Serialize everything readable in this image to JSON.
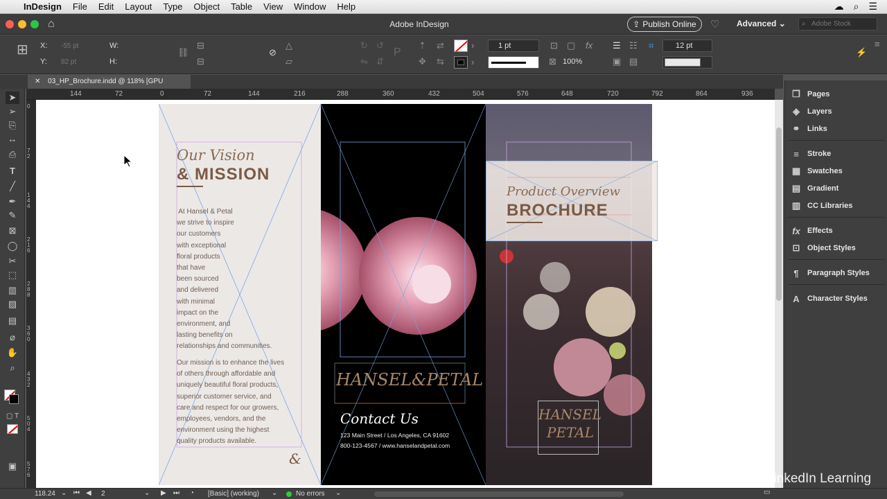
{
  "menubar": {
    "app_name": "InDesign",
    "items": [
      "File",
      "Edit",
      "Layout",
      "Type",
      "Object",
      "Table",
      "View",
      "Window",
      "Help"
    ]
  },
  "titlebar": {
    "title": "Adobe InDesign",
    "publish_label": "Publish Online",
    "workspace_label": "Advanced",
    "search_placeholder": "Adobe Stock"
  },
  "control_panel": {
    "x_label": "X:",
    "x_value": "-55 pt",
    "y_label": "Y:",
    "y_value": "82 pt",
    "w_label": "W:",
    "h_label": "H:",
    "stroke_weight": "1 pt",
    "opacity": "100%",
    "corner_size": "12 pt"
  },
  "document_tab": {
    "label": "03_HP_Brochure.indd @ 118% [GPU Preview]"
  },
  "ruler": {
    "h_ticks": [
      "144",
      "72",
      "0",
      "72",
      "144",
      "216",
      "288",
      "360",
      "432",
      "504",
      "576",
      "648",
      "720",
      "792",
      "864",
      "936"
    ],
    "v_ticks": [
      "0",
      "7\n2",
      "1\n4\n4",
      "2\n1\n6",
      "2\n8\n8",
      "3\n6\n0",
      "4\n3\n2",
      "5\n0\n4",
      "5\n7\n6"
    ]
  },
  "panels": {
    "items": [
      "Pages",
      "Layers",
      "Links",
      "Stroke",
      "Swatches",
      "Gradient",
      "CC Libraries",
      "Effects",
      "Object Styles",
      "Paragraph Styles",
      "Character Styles"
    ]
  },
  "brochure": {
    "mission_script": "Our Vision",
    "mission_title": "& MISSION",
    "mission_body_1": [
      " At Hansel & Petal",
      "we strive to inspire",
      "our customers",
      "with exceptional",
      "floral products",
      "that have",
      "been sourced",
      "and delivered",
      "with minimal",
      "impact on the",
      "environment, and",
      "lasting benefits on",
      "relationships and communities."
    ],
    "mission_body_2": [
      "Our mission is to enhance the lives",
      "of others through affordable and",
      "uniquely beautiful floral products,",
      "superior customer service, and",
      "care and respect for our growers,",
      "employees, vendors, and the",
      "environment using the highest",
      "quality products available."
    ],
    "logo_text": "HANSEL&PETAL",
    "contact_title": "Contact Us",
    "contact_address": "123 Main Street  /  Los Angeles, CA 91602",
    "contact_phone_web": "800-123-4567  /  www.hanselandpetal.com",
    "cover_script": "Product Overview",
    "cover_title": "BROCHURE",
    "cover_logo_line1": "HANSEL",
    "cover_logo_line2": "PETAL"
  },
  "status_bar": {
    "zoom": "118.24",
    "page": "2",
    "style": "[Basic] (working)",
    "errors": "No errors"
  },
  "watermark": "LinkedIn Learning"
}
